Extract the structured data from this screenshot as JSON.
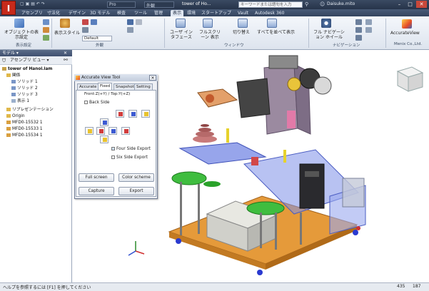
{
  "titlebar": {
    "app_logo": "I",
    "project": "Pro",
    "look": "外観",
    "document_title": "tower of Ho...",
    "search_placeholder": "キーワードまたは語句を入力",
    "user": "Daisuke.mito",
    "minimize": "–",
    "maximize": "□",
    "close": "✕"
  },
  "tabs": [
    "アセンブリ",
    "寸法化",
    "デザイン",
    "3D モデル",
    "検査",
    "ツール",
    "管理",
    "表示",
    "環境",
    "スタートアップ",
    "Vault",
    "Autodesk 360"
  ],
  "active_tab_index": 7,
  "ribbon": {
    "object_visibility": "オブジェクトの表示設定",
    "display_style": "表示スタイル",
    "default_value": "Default",
    "user_interface": "ユーザ インタフェース",
    "full_screen": "フルスクリーン 表示",
    "switch_windows": "切り替え",
    "arrange_all": "すべてを並べて表示",
    "full_navigation": "フル ナビゲーション ホイール",
    "accurateview": "AccurateView",
    "groups": {
      "visibility": "表示設定",
      "appearance": "外観",
      "window": "ウィンドウ",
      "navigation": "ナビゲーション",
      "vendor": "Menix Co.,Ltd."
    }
  },
  "browser": {
    "header": "モデル ▾",
    "view_selector": "アセンブリ ビュー ▾",
    "items": [
      {
        "label": "tower of Hanoi.iam",
        "level": 0
      },
      {
        "label": "関係",
        "level": 1
      },
      {
        "label": "ソリッド 1",
        "level": 2
      },
      {
        "label": "ソリッド 2",
        "level": 2
      },
      {
        "label": "ソリッド 3",
        "level": 2
      },
      {
        "label": "表示 1",
        "level": 2
      },
      {
        "label": "リプレゼンテーション",
        "level": 1
      },
      {
        "label": "Origin",
        "level": 1
      },
      {
        "label": "MFD0-15532 1",
        "level": 1
      },
      {
        "label": "MFD0-15533 1",
        "level": 1
      },
      {
        "label": "MFD0-15534 1",
        "level": 1
      }
    ]
  },
  "dialog": {
    "title": "Accurate View Tool",
    "tabs": [
      "Accurate",
      "Fixed",
      "Snapshot",
      "Setting"
    ],
    "active_tab": "Fixed",
    "subtitle": "Front:Z(+Y) / Top:Y(+Z)",
    "back_side": "Back Side",
    "four_side_export": "Four Side Export",
    "six_side_export": "Six Side Export",
    "full_screen": "Full screen",
    "color_scheme": "Color scheme",
    "capture": "Capture",
    "export": "Export"
  },
  "status": {
    "help": "ヘルプを参照するには [F1] を押してください",
    "num1": "435",
    "num2": "187"
  }
}
